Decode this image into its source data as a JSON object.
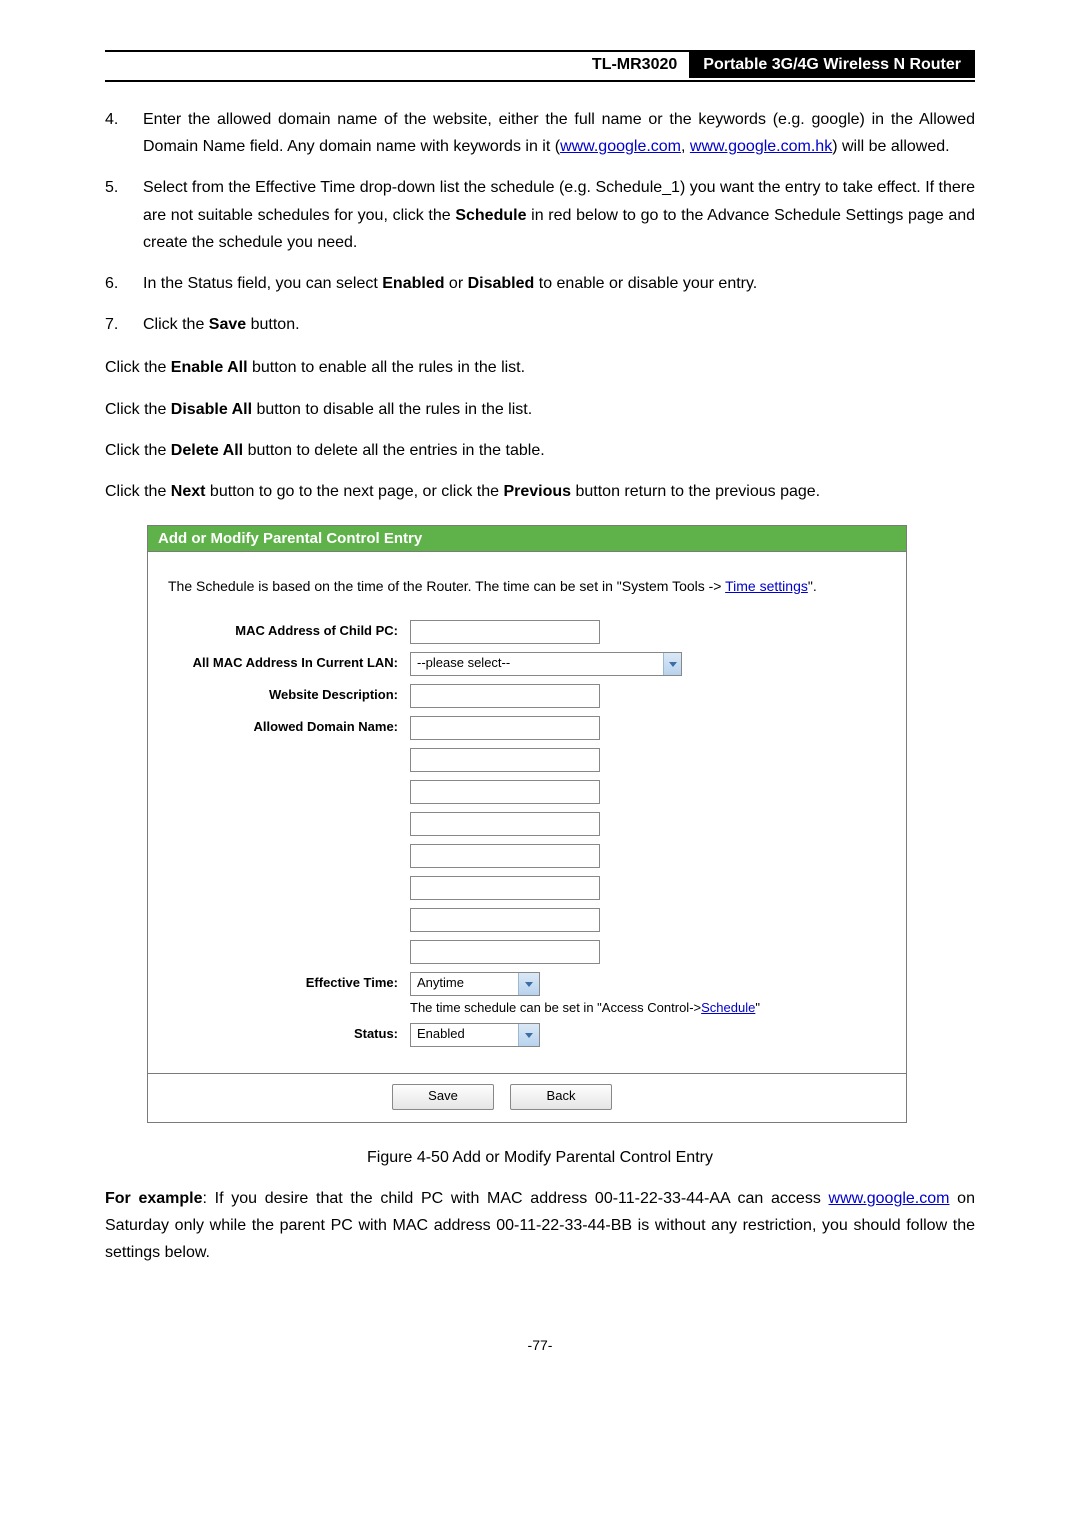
{
  "header": {
    "model": "TL-MR3020",
    "title": "Portable 3G/4G Wireless N Router"
  },
  "steps": [
    {
      "num": "4.",
      "prefix": "Enter the allowed domain name of the website, either the full name or the keywords (e.g. google) in the Allowed Domain Name field. Any domain name with keywords in it (",
      "link1": "www.google.com",
      "mid": ", ",
      "link2": "www.google.com.hk",
      "suffix": ") will be allowed."
    },
    {
      "num": "5.",
      "text_a": "Select from the Effective Time drop-down list the schedule (e.g. Schedule_1) you want the entry to take effect. If there are not suitable schedules for you, click the ",
      "bold": "Schedule",
      "text_b": " in red below to go to the Advance Schedule Settings page and create the schedule you need."
    },
    {
      "num": "6.",
      "text_a": "In the Status field, you can select ",
      "bold1": "Enabled",
      "mid": " or ",
      "bold2": "Disabled",
      "text_b": " to enable or disable your entry."
    },
    {
      "num": "7.",
      "text_a": "Click the ",
      "bold": "Save",
      "text_b": " button."
    }
  ],
  "paras": {
    "p1a": "Click the ",
    "p1b": "Enable All",
    "p1c": " button to enable all the rules in the list.",
    "p2a": "Click the ",
    "p2b": "Disable All",
    "p2c": " button to disable all the rules in the list.",
    "p3a": "Click the ",
    "p3b": "Delete All",
    "p3c": " button to delete all the entries in the table.",
    "p4a": "Click the ",
    "p4b": "Next",
    "p4c": " button to go to the next page, or click the ",
    "p4d": "Previous",
    "p4e": " button return to the previous page."
  },
  "panel": {
    "title": "Add or Modify Parental Control Entry",
    "note_a": "The Schedule is based on the time of the Router. The time can be set in \"System Tools -> ",
    "note_link": "Time settings",
    "note_b": "\".",
    "labels": {
      "mac": "MAC Address of Child PC:",
      "allmac": "All MAC Address In Current LAN:",
      "desc": "Website Description:",
      "domain": "Allowed Domain Name:",
      "time": "Effective Time:",
      "status": "Status:"
    },
    "values": {
      "allmac": "--please select--",
      "time": "Anytime",
      "status": "Enabled"
    },
    "hint_a": "The time schedule can be set in \"Access Control->",
    "hint_link": "Schedule",
    "hint_b": "\"",
    "buttons": {
      "save": "Save",
      "back": "Back"
    }
  },
  "figcap": "Figure 4-50    Add or Modify Parental Control Entry",
  "example": {
    "a": "For example",
    "b": ": If you desire that the child PC with MAC address 00-11-22-33-44-AA can access ",
    "link": "www.google.com",
    "c": " on Saturday only while the parent PC with MAC address 00-11-22-33-44-BB is without any restriction, you should follow the settings below."
  },
  "pagenum": "-77-"
}
